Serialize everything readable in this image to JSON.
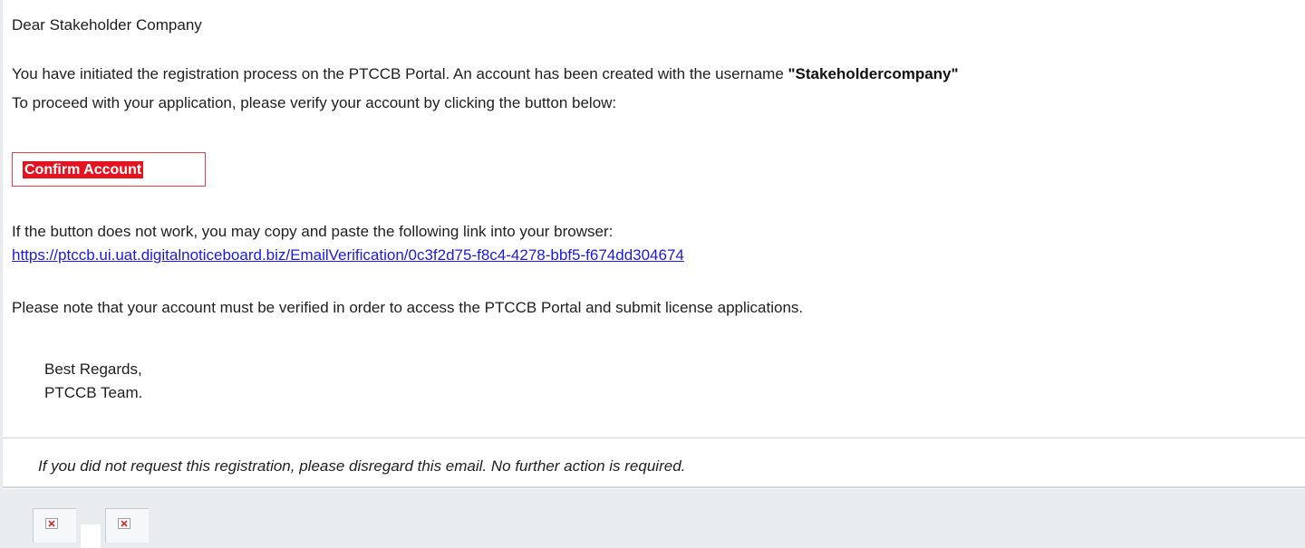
{
  "email": {
    "greeting": "Dear Stakeholder Company",
    "intro_text": "You have initiated the registration process on the PTCCB Portal. An account has been created with the username ",
    "username": "\"Stakeholdercompany\"",
    "proceed_text": "To proceed with your application, please verify your account by clicking the button below:",
    "confirm_button_label": "Confirm Account",
    "fallback_text": "If the button does not work, you may copy and paste the following link into your browser:",
    "verification_link": "https://ptccb.ui.uat.digitalnoticeboard.biz/EmailVerification/0c3f2d75-f8c4-4278-bbf5-f674dd304674",
    "note_text": "Please note that your account must be verified in order to access the PTCCB Portal and submit license applications.",
    "closing": "Best Regards,",
    "signature": "PTCCB Team.",
    "disclaimer": "If you did not request this registration, please disregard this email. No further action is required."
  },
  "footer": {
    "images": [
      {
        "icon": "broken-image-icon"
      },
      {
        "icon": "broken-image-icon"
      }
    ]
  },
  "colors": {
    "button_red": "#e3141f",
    "button_border": "#e8404a",
    "link_blue": "#1a1ae8",
    "footer_gray": "#e9ecef"
  }
}
